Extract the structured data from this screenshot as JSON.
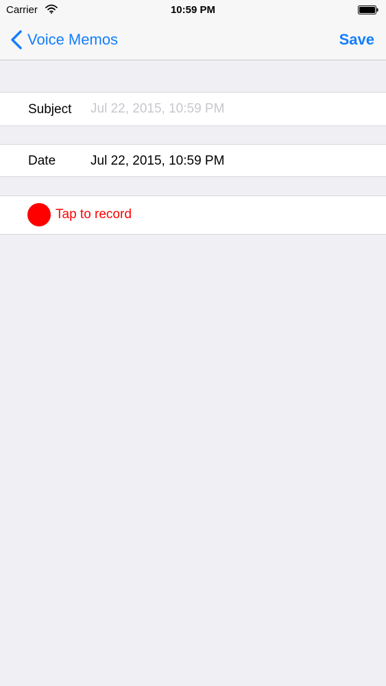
{
  "status_bar": {
    "carrier": "Carrier",
    "time": "10:59 PM"
  },
  "nav": {
    "back_label": "Voice Memos",
    "save_label": "Save",
    "accent_color": "#147efb"
  },
  "form": {
    "subject": {
      "label": "Subject",
      "value": "",
      "placeholder": "Jul 22, 2015, 10:59 PM"
    },
    "date": {
      "label": "Date",
      "value": "Jul 22, 2015, 10:59 PM"
    },
    "record": {
      "label": "Tap to record",
      "color": "#ff0000",
      "icon": "record-dot-icon"
    }
  }
}
